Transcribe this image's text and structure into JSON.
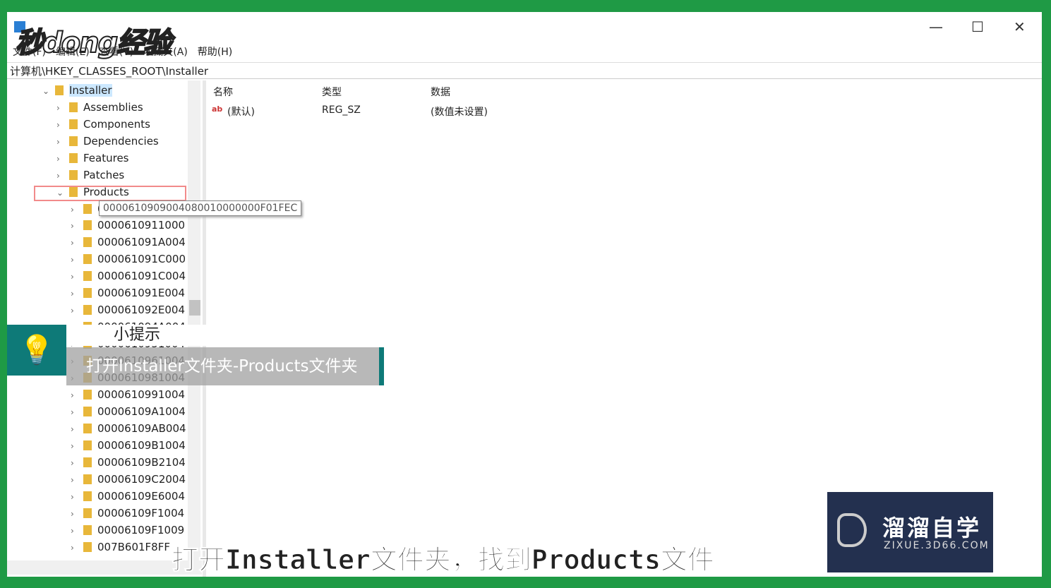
{
  "window": {
    "watermark": "秒dong经验",
    "minimize": "—",
    "maximize": "☐",
    "close": "✕"
  },
  "menu": [
    "文件(F)",
    "编辑(E)",
    "查看(V)",
    "收藏夹(A)",
    "帮助(H)"
  ],
  "address": "计算机\\HKEY_CLASSES_ROOT\\Installer",
  "tree": [
    {
      "label": "Installer",
      "level": 0,
      "expanded": true,
      "selected": true
    },
    {
      "label": "Assemblies",
      "level": 1
    },
    {
      "label": "Components",
      "level": 1
    },
    {
      "label": "Dependencies",
      "level": 1
    },
    {
      "label": "Features",
      "level": 1
    },
    {
      "label": "Patches",
      "level": 1
    },
    {
      "label": "Products",
      "level": 1,
      "expanded": true
    },
    {
      "label": "0000610909004080010000000F01FEC",
      "level": 2
    },
    {
      "label": "0000610911000",
      "level": 2
    },
    {
      "label": "000061091A004",
      "level": 2
    },
    {
      "label": "000061091C000",
      "level": 2
    },
    {
      "label": "000061091C004",
      "level": 2
    },
    {
      "label": "000061091E004",
      "level": 2
    },
    {
      "label": "000061092E004",
      "level": 2
    },
    {
      "label": "000061094A004",
      "level": 2
    },
    {
      "label": "0000610951004",
      "level": 2
    },
    {
      "label": "0000610961004",
      "level": 2
    },
    {
      "label": "0000610981004",
      "level": 2
    },
    {
      "label": "0000610991004",
      "level": 2
    },
    {
      "label": "00006109A1004",
      "level": 2
    },
    {
      "label": "00006109AB004",
      "level": 2
    },
    {
      "label": "00006109B1004",
      "level": 2
    },
    {
      "label": "00006109B2104",
      "level": 2
    },
    {
      "label": "00006109C2004",
      "level": 2
    },
    {
      "label": "00006109E6004",
      "level": 2
    },
    {
      "label": "00006109F1004",
      "level": 2
    },
    {
      "label": "00006109F1009",
      "level": 2
    },
    {
      "label": "007B601F8FF",
      "level": 2
    }
  ],
  "tooltip": "0000610909004080010000000F01FEC",
  "columns": [
    "名称",
    "类型",
    "数据"
  ],
  "values": [
    {
      "name": "(默认)",
      "type": "REG_SZ",
      "data": "(数值未设置)",
      "icon": "ab-string-icon"
    }
  ],
  "tip": {
    "title": "小提示",
    "body": "打开Installer文件夹-Products文件夹"
  },
  "subtitle": "打开Installer文件夹，找到Products文件",
  "brand": {
    "name": "溜溜自学",
    "url": "ZIXUE.3D66.COM"
  },
  "colors": {
    "accent": "#0e7a78",
    "background": "#1f9a45",
    "brand": "#23304f"
  }
}
